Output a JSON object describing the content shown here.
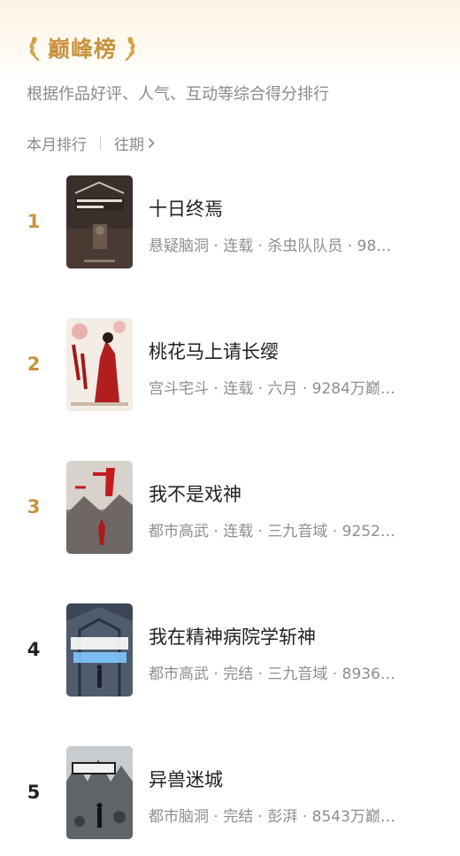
{
  "header": {
    "title": "巅峰榜",
    "subtitle": "根据作品好评、人气、互动等综合得分排行",
    "accent_color": "#c8923e",
    "laurel_icon": "laurel-icon"
  },
  "tabs": {
    "current": "本月排行",
    "history": "往期",
    "history_icon": "chevron-right-icon"
  },
  "books": [
    {
      "rank": "1",
      "rank_color": "#c8923e",
      "title": "十日终焉",
      "meta": "悬疑脑洞 · 连载 · 杀虫队队员 · 98…"
    },
    {
      "rank": "2",
      "rank_color": "#c8923e",
      "title": "桃花马上请长缨",
      "meta": "宫斗宅斗 · 连载 · 六月 · 9284万巅…"
    },
    {
      "rank": "3",
      "rank_color": "#c8923e",
      "title": "我不是戏神",
      "meta": "都市高武 · 连载 · 三九音域 · 9252…"
    },
    {
      "rank": "4",
      "rank_color": "#222222",
      "title": "我在精神病院学斩神",
      "meta": "都市高武 · 完结 · 三九音域 · 8936…"
    },
    {
      "rank": "5",
      "rank_color": "#222222",
      "title": "异兽迷城",
      "meta": "都市脑洞 · 完结 · 彭湃 · 8543万巅…"
    }
  ]
}
